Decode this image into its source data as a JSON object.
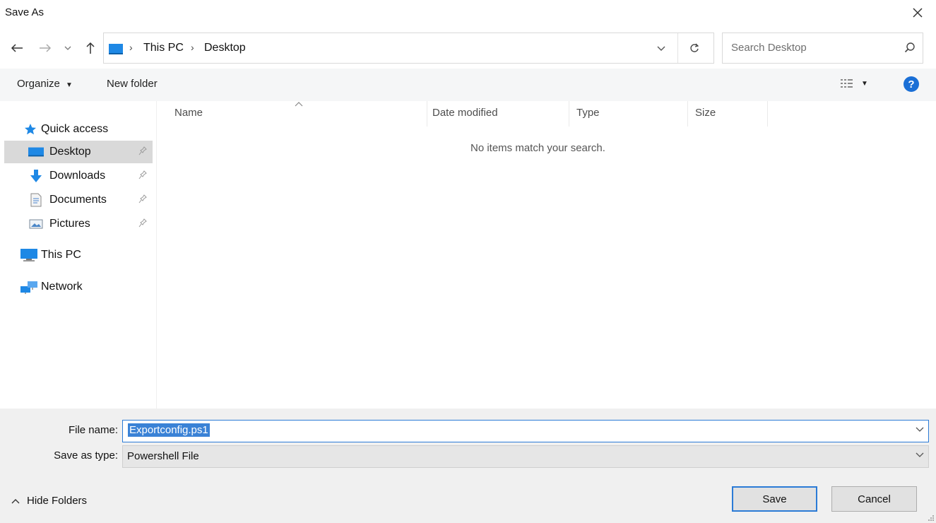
{
  "window": {
    "title": "Save As"
  },
  "nav": {
    "breadcrumb": [
      "This PC",
      "Desktop"
    ],
    "search_placeholder": "Search Desktop"
  },
  "toolbar": {
    "organize": "Organize",
    "new_folder": "New folder"
  },
  "sidebar": {
    "quick_access": "Quick access",
    "items": [
      {
        "label": "Desktop",
        "icon": "desktop-icon",
        "pinned": true,
        "selected": true
      },
      {
        "label": "Downloads",
        "icon": "downloads-icon",
        "pinned": true
      },
      {
        "label": "Documents",
        "icon": "documents-icon",
        "pinned": true
      },
      {
        "label": "Pictures",
        "icon": "pictures-icon",
        "pinned": true
      }
    ],
    "this_pc": "This PC",
    "network": "Network"
  },
  "file_list": {
    "columns": [
      "Name",
      "Date modified",
      "Type",
      "Size"
    ],
    "empty_message": "No items match your search."
  },
  "form": {
    "file_name_label": "File name:",
    "file_name_value": "Exportconfig.ps1",
    "save_type_label": "Save as type:",
    "save_type_value": "Powershell File"
  },
  "footer": {
    "hide_folders": "Hide Folders",
    "save": "Save",
    "cancel": "Cancel"
  },
  "colors": {
    "accent": "#2b7bd6",
    "selection": "#3a82d6",
    "help": "#1a6fd6",
    "folder_blue": "#1e88e5"
  }
}
